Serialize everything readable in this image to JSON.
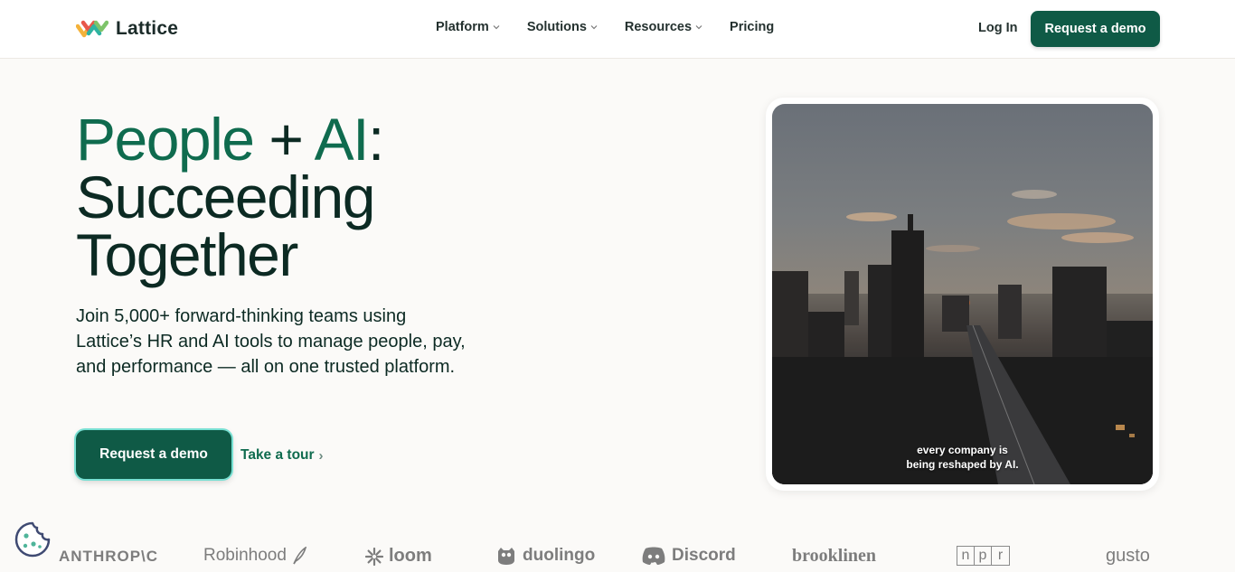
{
  "header": {
    "logo_text": "Lattice",
    "nav": [
      {
        "label": "Platform",
        "has_dropdown": true
      },
      {
        "label": "Solutions",
        "has_dropdown": true
      },
      {
        "label": "Resources",
        "has_dropdown": true
      },
      {
        "label": "Pricing",
        "has_dropdown": false
      }
    ],
    "login_label": "Log In",
    "cta_label": "Request a demo"
  },
  "hero": {
    "title_part1": "People",
    "title_plus": " + ",
    "title_part2": "AI",
    "title_colon": ":",
    "title_line2": "Succeeding",
    "title_line3": "Together",
    "subtitle": "Join 5,000+ forward-thinking teams using Lattice’s HR and AI tools to manage people, pay, and performance — all on one trusted platform.",
    "cta_label": "Request a demo",
    "tour_label": "Take a tour",
    "tour_arrow": "›"
  },
  "video": {
    "caption_line1": "every company is",
    "caption_line2": "being reshaped by AI."
  },
  "logos": {
    "anthropic": "ANTHROP\\C",
    "robinhood": "Robinhood",
    "loom": "loom",
    "duolingo": "duolingo",
    "discord": "Discord",
    "brooklinen": "brooklinen",
    "npr": [
      "n",
      "p",
      "r"
    ],
    "gusto": "gusto"
  },
  "colors": {
    "brand_green": "#0f5a46",
    "title_green": "#0f6b4e",
    "cta_glow": "#79e0d3"
  },
  "icons": [
    "lattice-logo-icon",
    "chevron-down-icon",
    "chevron-right-icon",
    "cookie-icon",
    "robinhood-feather-icon",
    "loom-icon",
    "duolingo-owl-icon",
    "discord-icon"
  ]
}
